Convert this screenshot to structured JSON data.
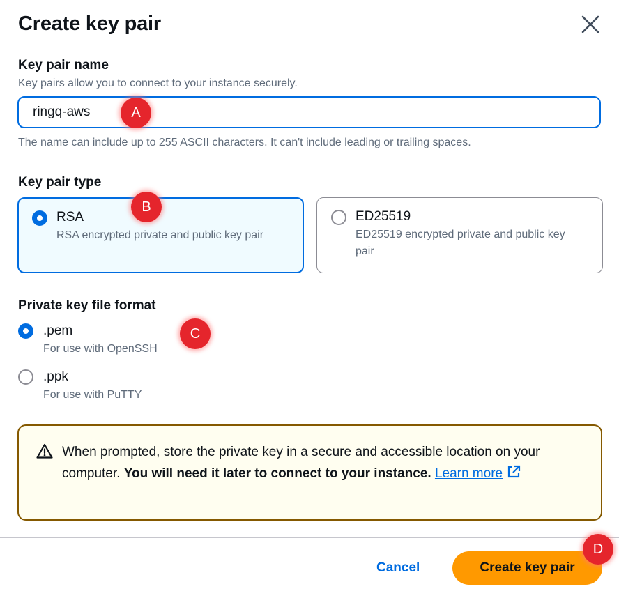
{
  "dialog": {
    "title": "Create key pair"
  },
  "key_name": {
    "label": "Key pair name",
    "description": "Key pairs allow you to connect to your instance securely.",
    "value": "ringq-aws",
    "constraint": "The name can include up to 255 ASCII characters. It can't include leading or trailing spaces."
  },
  "key_type": {
    "label": "Key pair type",
    "options": [
      {
        "title": "RSA",
        "description": "RSA encrypted private and public key pair",
        "selected": true
      },
      {
        "title": "ED25519",
        "description": "ED25519 encrypted private and public key pair",
        "selected": false
      }
    ]
  },
  "file_format": {
    "label": "Private key file format",
    "options": [
      {
        "title": ".pem",
        "description": "For use with OpenSSH",
        "selected": true
      },
      {
        "title": ".ppk",
        "description": "For use with PuTTY",
        "selected": false
      }
    ]
  },
  "alert": {
    "text": "When prompted, store the private key in a secure and accessible location on your computer.",
    "bold_text": "You will need it later to connect to your instance.",
    "link_text": "Learn more"
  },
  "footer": {
    "cancel_label": "Cancel",
    "create_label": "Create key pair"
  },
  "annotations": [
    "A",
    "B",
    "C",
    "D"
  ],
  "colors": {
    "primary": "#ff9900",
    "accent": "#006ce0",
    "warning_border": "#855900",
    "marker": "#e5252c"
  }
}
